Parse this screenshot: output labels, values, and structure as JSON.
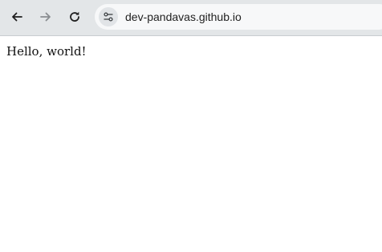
{
  "browser": {
    "url": "dev-pandavas.github.io",
    "icons": {
      "back": "back-arrow-icon",
      "forward": "forward-arrow-icon",
      "reload": "reload-icon",
      "site_info": "tune-icon"
    },
    "forward_enabled": false
  },
  "page": {
    "body_text": "Hello, world!"
  }
}
